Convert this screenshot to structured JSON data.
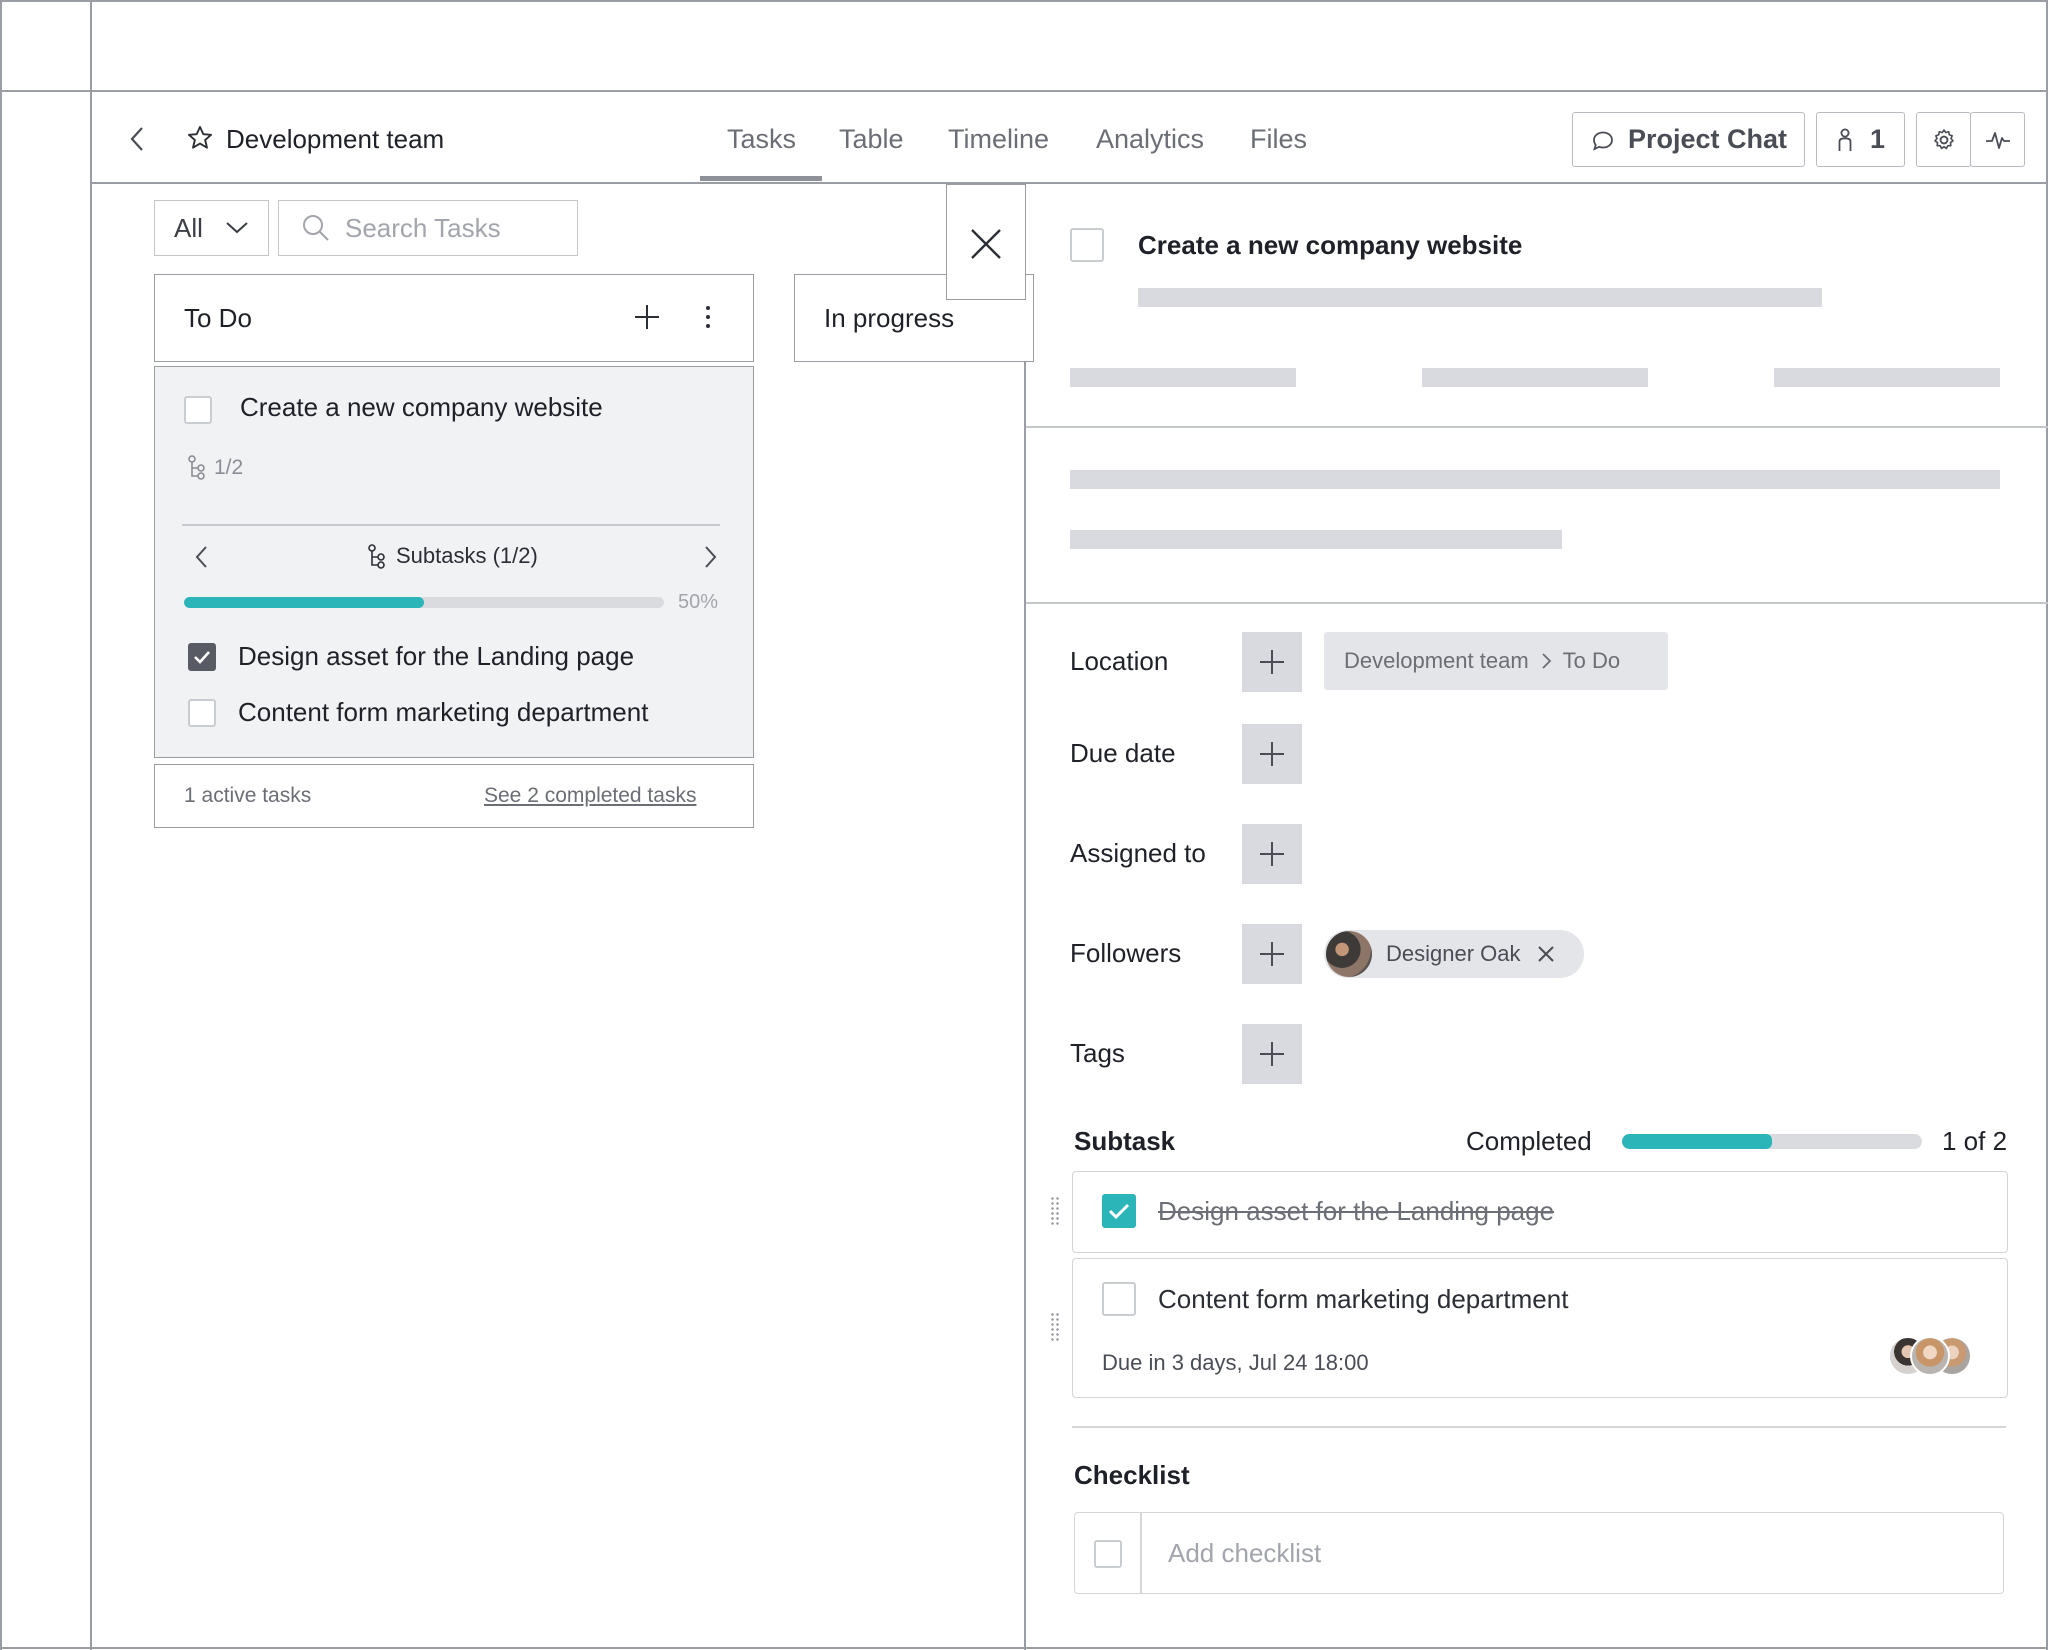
{
  "header": {
    "project_title": "Development team",
    "tabs": [
      {
        "label": "Tasks",
        "active": true
      },
      {
        "label": "Table"
      },
      {
        "label": "Timeline"
      },
      {
        "label": "Analytics"
      },
      {
        "label": "Files"
      }
    ],
    "project_chat_label": "Project Chat",
    "members_count": "1"
  },
  "board": {
    "filter_value": "All",
    "search_placeholder": "Search Tasks",
    "columns": [
      {
        "name": "To Do"
      },
      {
        "name": "In progress"
      }
    ],
    "card": {
      "title": "Create a new company website",
      "subtask_count": "1/2",
      "subtasks_label": "Subtasks (1/2)",
      "progress_fraction": 0.5,
      "progress_pct_label": "50%",
      "subtasks": [
        {
          "label": "Design asset for the Landing page",
          "checked": true
        },
        {
          "label": "Content form marketing department",
          "checked": false
        }
      ]
    },
    "footer": {
      "active_tasks": "1 active tasks",
      "completed_link": "See 2 completed tasks"
    }
  },
  "detail": {
    "title": "Create a new company website",
    "fields": {
      "location_label": "Location",
      "location_project": "Development team",
      "location_column": "To Do",
      "due_date_label": "Due date",
      "assigned_label": "Assigned to",
      "followers_label": "Followers",
      "follower_name": "Designer Oak",
      "tags_label": "Tags"
    },
    "subtask_section": {
      "heading": "Subtask",
      "completed_label": "Completed",
      "progress_fraction": 0.5,
      "count_label": "1 of 2",
      "items": [
        {
          "label": "Design asset for the Landing page",
          "done": true
        },
        {
          "label": "Content form marketing department",
          "done": false,
          "due": "Due in 3 days, Jul 24 18:00"
        }
      ]
    },
    "checklist": {
      "heading": "Checklist",
      "placeholder": "Add checklist"
    }
  },
  "colors": {
    "accent_teal": "#2bb5b8",
    "skeleton_gray": "#d9dadf",
    "border_gray": "#9a9da3"
  },
  "icons": [
    "chevron-left-icon",
    "star-icon",
    "chat-icon",
    "person-icon",
    "gear-icon",
    "activity-icon",
    "chevron-down-icon",
    "search-icon",
    "plus-icon",
    "more-vertical-icon",
    "subtask-icon",
    "chevron-right-icon",
    "close-icon",
    "drag-handle-icon"
  ]
}
